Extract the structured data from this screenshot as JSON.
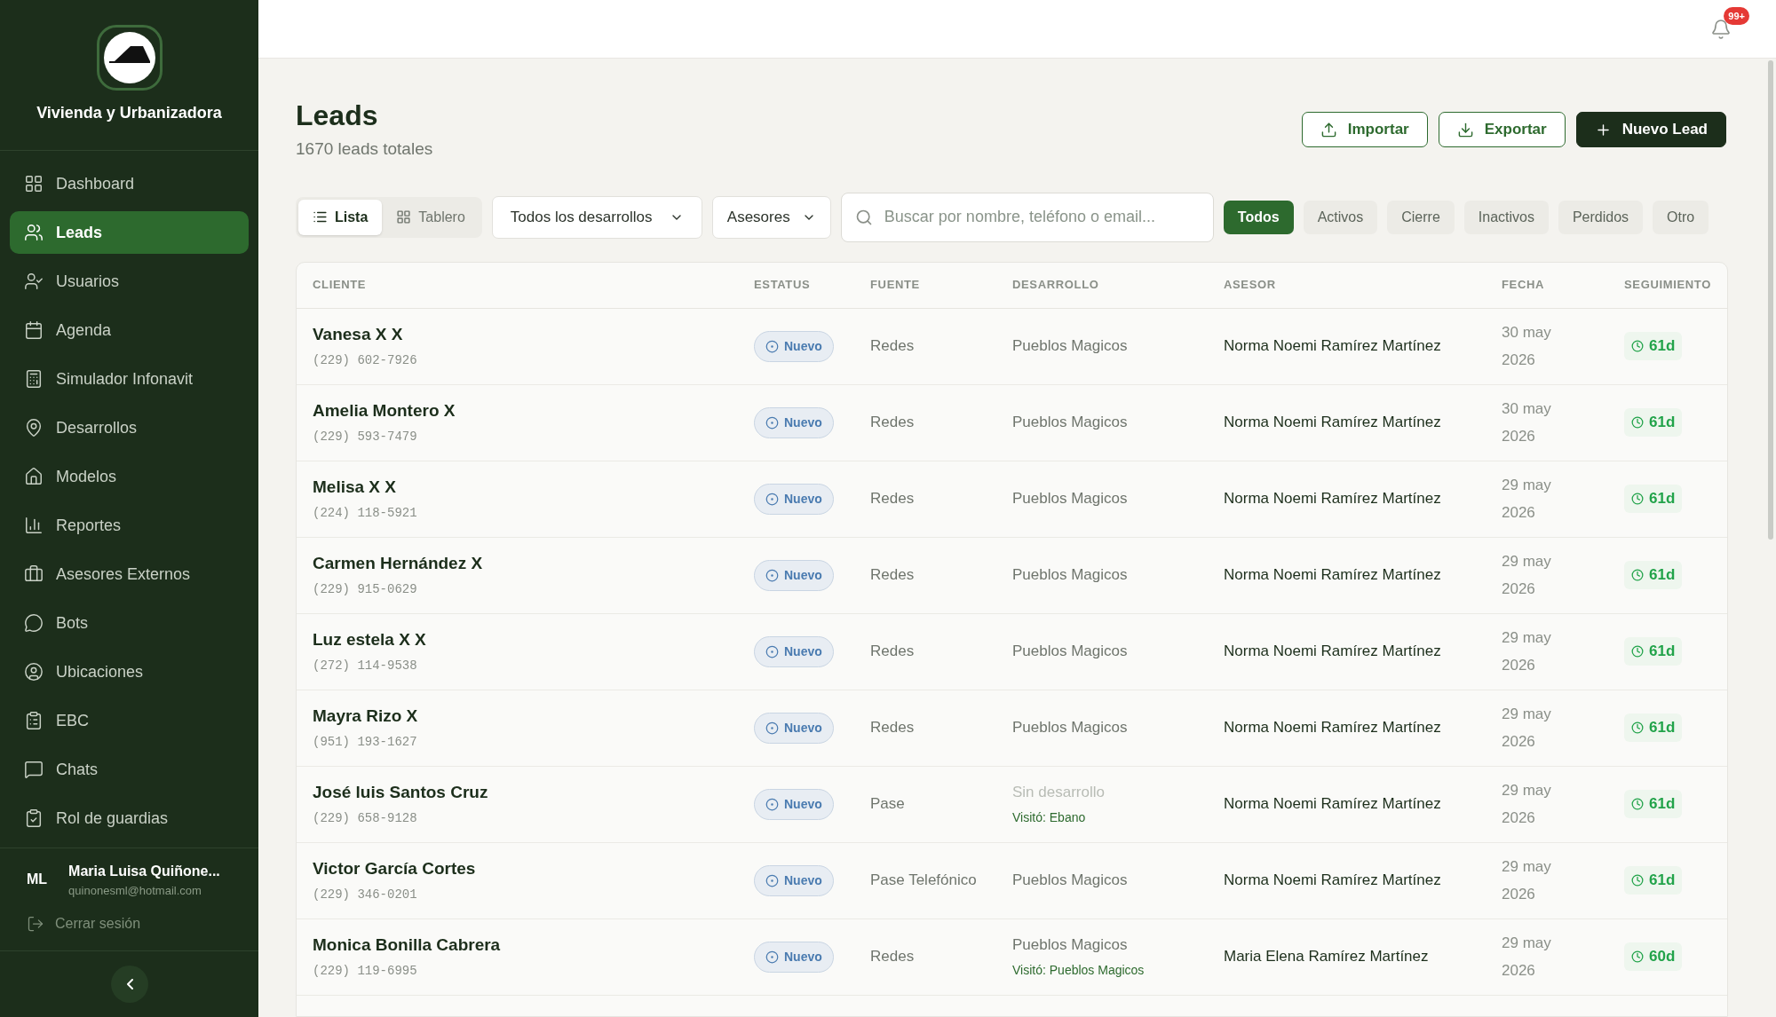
{
  "brand": {
    "name": "Vivienda y Urbanizadora"
  },
  "sidebar": {
    "items": [
      {
        "label": "Dashboard",
        "selected": false
      },
      {
        "label": "Leads",
        "selected": true
      },
      {
        "label": "Usuarios",
        "selected": false
      },
      {
        "label": "Agenda",
        "selected": false
      },
      {
        "label": "Simulador Infonavit",
        "selected": false
      },
      {
        "label": "Desarrollos",
        "selected": false
      },
      {
        "label": "Modelos",
        "selected": false
      },
      {
        "label": "Reportes",
        "selected": false
      },
      {
        "label": "Asesores Externos",
        "selected": false
      },
      {
        "label": "Bots",
        "selected": false
      },
      {
        "label": "Ubicaciones",
        "selected": false
      },
      {
        "label": "EBC",
        "selected": false
      },
      {
        "label": "Chats",
        "selected": false
      },
      {
        "label": "Rol de guardias",
        "selected": false
      }
    ]
  },
  "user": {
    "initials": "ML",
    "name": "Maria Luisa Quiñone...",
    "email": "quinonesml@hotmail.com",
    "logout": "Cerrar sesión"
  },
  "notifications": {
    "badge": "99+"
  },
  "page": {
    "title": "Leads",
    "subtitle": "1670 leads totales",
    "buttons": [
      {
        "label": "Importar",
        "kind": "import"
      },
      {
        "label": "Exportar",
        "kind": "export"
      },
      {
        "label": "Nuevo Lead",
        "kind": "new"
      }
    ]
  },
  "views": [
    {
      "label": "Lista",
      "selected": true
    },
    {
      "label": "Tablero",
      "selected": false
    }
  ],
  "filters": {
    "desarrollo": "Todos los desarrollos",
    "asesores": "Asesores",
    "search_placeholder": "Buscar por nombre, teléfono o email..."
  },
  "status_tabs": [
    {
      "label": "Todos",
      "selected": true
    },
    {
      "label": "Activos",
      "selected": false
    },
    {
      "label": "Cierre",
      "selected": false
    },
    {
      "label": "Inactivos",
      "selected": false
    },
    {
      "label": "Perdidos",
      "selected": false
    },
    {
      "label": "Otro",
      "selected": false
    }
  ],
  "table": {
    "columns": [
      "CLIENTE",
      "ESTATUS",
      "FUENTE",
      "DESARROLLO",
      "ASESOR",
      "FECHA",
      "SEGUIMIENTO"
    ],
    "rows": [
      {
        "name": "Vanesa X X",
        "phone": "(229) 602-7926",
        "status": "Nuevo",
        "source": "Redes",
        "desarrollo": "Pueblos Magicos",
        "desarrollo_empty": false,
        "asesor": "Norma Noemi Ramírez Martínez",
        "date": [
          "30 may",
          "2026"
        ],
        "followup": "61d"
      },
      {
        "name": "Amelia Montero X",
        "phone": "(229) 593-7479",
        "status": "Nuevo",
        "source": "Redes",
        "desarrollo": "Pueblos Magicos",
        "desarrollo_empty": false,
        "asesor": "Norma Noemi Ramírez Martínez",
        "date": [
          "30 may",
          "2026"
        ],
        "followup": "61d"
      },
      {
        "name": "Melisa X X",
        "phone": "(224) 118-5921",
        "status": "Nuevo",
        "source": "Redes",
        "desarrollo": "Pueblos Magicos",
        "desarrollo_empty": false,
        "asesor": "Norma Noemi Ramírez Martínez",
        "date": [
          "29 may",
          "2026"
        ],
        "followup": "61d"
      },
      {
        "name": "Carmen Hernández X",
        "phone": "(229) 915-0629",
        "status": "Nuevo",
        "source": "Redes",
        "desarrollo": "Pueblos Magicos",
        "desarrollo_empty": false,
        "asesor": "Norma Noemi Ramírez Martínez",
        "date": [
          "29 may",
          "2026"
        ],
        "followup": "61d"
      },
      {
        "name": "Luz estela X X",
        "phone": "(272) 114-9538",
        "status": "Nuevo",
        "source": "Redes",
        "desarrollo": "Pueblos Magicos",
        "desarrollo_empty": false,
        "asesor": "Norma Noemi Ramírez Martínez",
        "date": [
          "29 may",
          "2026"
        ],
        "followup": "61d"
      },
      {
        "name": "Mayra Rizo X",
        "phone": "(951) 193-1627",
        "status": "Nuevo",
        "source": "Redes",
        "desarrollo": "Pueblos Magicos",
        "desarrollo_empty": false,
        "asesor": "Norma Noemi Ramírez Martínez",
        "date": [
          "29 may",
          "2026"
        ],
        "followup": "61d"
      },
      {
        "name": "José luis Santos Cruz",
        "phone": "(229) 658-9128",
        "status": "Nuevo",
        "source": "Pase",
        "desarrollo": "Sin desarrollo",
        "desarrollo_empty": true,
        "visit": "Visitó: Ebano",
        "asesor": "Norma Noemi Ramírez Martínez",
        "date": [
          "29 may",
          "2026"
        ],
        "followup": "61d"
      },
      {
        "name": "Victor García Cortes",
        "phone": "(229) 346-0201",
        "status": "Nuevo",
        "source": "Pase Telefónico",
        "desarrollo": "Pueblos Magicos",
        "desarrollo_empty": false,
        "asesor": "Norma Noemi Ramírez Martínez",
        "date": [
          "29 may",
          "2026"
        ],
        "followup": "61d"
      },
      {
        "name": "Monica Bonilla Cabrera",
        "phone": "(229) 119-6995",
        "status": "Nuevo",
        "source": "Redes",
        "desarrollo": "Pueblos Magicos",
        "desarrollo_empty": false,
        "visit": "Visitó: Pueblos Magicos",
        "asesor": "Maria Elena Ramírez Martínez",
        "date": [
          "29 may",
          "2026"
        ],
        "followup": "60d"
      }
    ]
  }
}
